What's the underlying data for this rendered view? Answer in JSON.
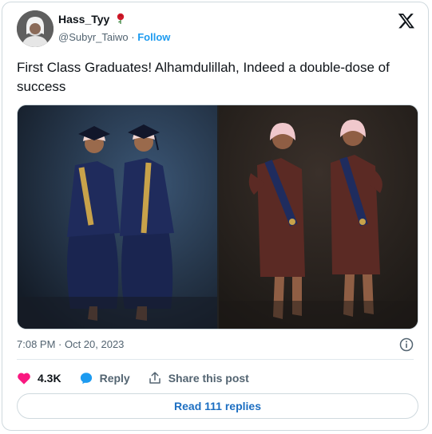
{
  "author": {
    "display_name": "Hass_Tyy",
    "handle": "@Subyr_Taiwo",
    "separator": "·",
    "follow_label": "Follow"
  },
  "tweet": {
    "text": "First Class Graduates! Alhamdulillah, Indeed a double-dose of success",
    "timestamp": "7:08 PM · Oct 20, 2023"
  },
  "actions": {
    "likes": "4.3K",
    "reply_label": "Reply",
    "share_label": "Share this post"
  },
  "footer": {
    "read_replies_label": "Read 111 replies"
  },
  "colors": {
    "accent": "#1d9bf0",
    "like": "#f91880",
    "muted": "#536471",
    "border": "#cfd9de"
  },
  "icons": [
    "rose-emoji-icon",
    "x-logo-icon",
    "info-icon",
    "heart-icon",
    "reply-bubble-icon",
    "share-icon"
  ]
}
